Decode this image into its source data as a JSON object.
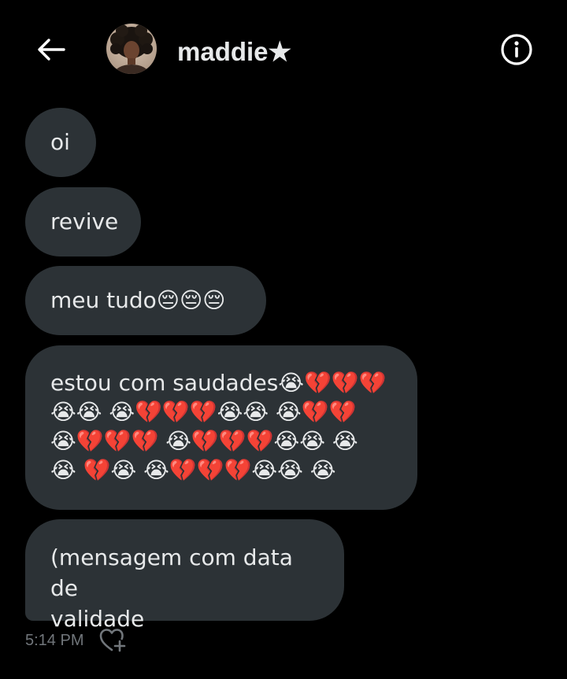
{
  "header": {
    "title": "maddie★",
    "back_icon": "arrow-left-icon",
    "info_icon": "info-circle-icon",
    "avatar": "contact-avatar"
  },
  "messages": [
    {
      "text": "oi"
    },
    {
      "text": "revive"
    },
    {
      "text": "meu tudo😔😔😔"
    },
    {
      "text": "estou com saudades😭💔💔💔\n😭😭 😭💔💔💔😭😭 😭💔💔\n😭💔💔💔 😭💔💔💔😭😭 😭\n😭 💔😭 😭💔💔💔😭😭 😭"
    },
    {
      "text": "(mensagem com data de\nvalidade"
    }
  ],
  "footer": {
    "timestamp": "5:14 PM",
    "react_icon": "heart-plus-icon"
  },
  "colors": {
    "background": "#000000",
    "bubble": "#2c3236",
    "text": "#e7e9ea",
    "muted": "#71767b"
  }
}
